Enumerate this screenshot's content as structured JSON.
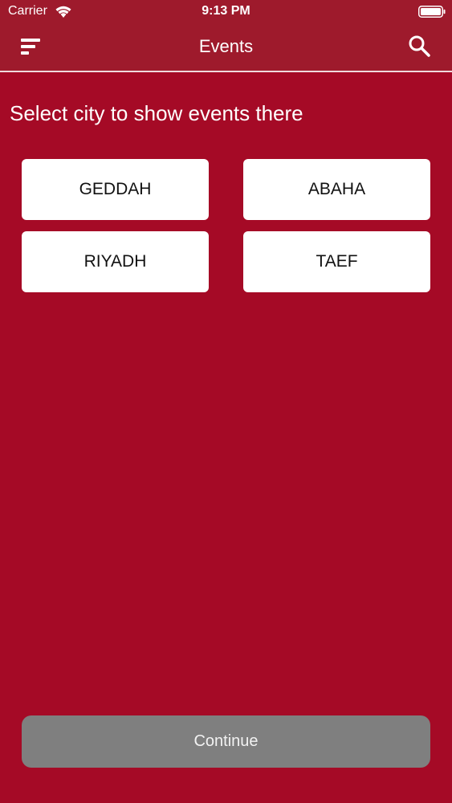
{
  "status_bar": {
    "carrier": "Carrier",
    "time": "9:13 PM",
    "icons": [
      "wifi-icon",
      "battery-icon"
    ]
  },
  "nav": {
    "title": "Events",
    "left_icon": "menu-icon",
    "right_icon": "search-icon"
  },
  "main": {
    "prompt": "Select city to show events there",
    "cities": [
      {
        "label": "GEDDAH"
      },
      {
        "label": "ABAHA"
      },
      {
        "label": "RIYADH"
      },
      {
        "label": "TAEF"
      }
    ]
  },
  "footer": {
    "continue_label": "Continue"
  },
  "colors": {
    "background": "#a50a26",
    "nav_background": "#9e1a2c",
    "button_background": "#ffffff",
    "continue_background": "#7f7f7f"
  }
}
